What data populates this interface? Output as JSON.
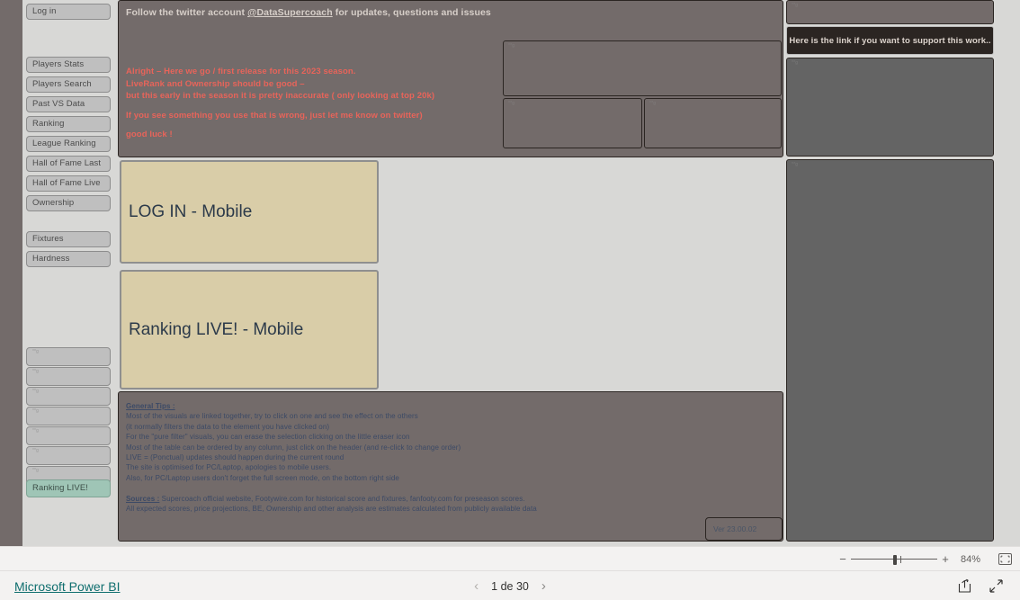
{
  "app": {
    "bottom_link": "Microsoft Power BI",
    "page_label": "1 de 30",
    "zoom_level": "84%",
    "prev_icon": "chevron-left-icon",
    "next_icon": "chevron-right-icon",
    "zoom_out_icon": "minus-icon",
    "zoom_in_icon": "plus-icon",
    "fit_icon": "fit-to-page-icon",
    "share_icon": "share-icon",
    "fullscreen_icon": "fullscreen-icon"
  },
  "sidebar": {
    "items": [
      {
        "label": "Log in",
        "active": false
      },
      {
        "label": "Players Stats",
        "active": false
      },
      {
        "label": "Players Search",
        "active": false
      },
      {
        "label": "Past VS Data",
        "active": false
      },
      {
        "label": "Ranking",
        "active": false
      },
      {
        "label": "League Ranking",
        "active": false
      },
      {
        "label": "Hall of Fame Last",
        "active": false
      },
      {
        "label": "Hall of Fame Live",
        "active": false
      },
      {
        "label": "Ownership",
        "active": false
      },
      {
        "label": "Fixtures",
        "active": false
      },
      {
        "label": "Hardness",
        "active": false
      }
    ],
    "blank_items": [
      {
        "label": "**g"
      },
      {
        "label": "**g"
      },
      {
        "label": "**g"
      },
      {
        "label": "**g"
      },
      {
        "label": "**g"
      },
      {
        "label": "**g"
      },
      {
        "label": "**g"
      }
    ],
    "live_item": {
      "label": "Ranking LIVE!"
    }
  },
  "top_card": {
    "twitter_prefix": "Follow the twitter account ",
    "twitter_handle": "@DataSupercoach",
    "twitter_suffix": " for updates, questions and issues",
    "release_line1": "Alright – Here we go / first release for this 2023 season.",
    "release_line2": "LiveRank and Ownership should be good –",
    "release_line3": "but  this early in the season it is pretty inaccurate ( only looking at top 20k)",
    "release_line4": "If you see something you use that is wrong, just let me know on twitter)",
    "release_line5": "good luck !"
  },
  "tiles": {
    "login": "LOG IN - Mobile",
    "ranking_live": "Ranking LIVE! - Mobile"
  },
  "tips": {
    "general_heading": "General Tips :",
    "general_lines": [
      "Most of the visuals are linked together, try to click on one and see the effect on the others",
      "(it normally filters the data to the element you have clicked on)",
      "For the \"pure filter\" visuals, you can erase the selection clicking on the little eraser icon",
      "Most of the table can be ordered by any column, just click on the header (and re-click to change order)",
      "LIVE = (Ponctual) updates should happen during  the current round",
      "The site is optimised for PC/Laptop, apologies to mobile users.",
      "Also, for PC/Laptop users don't forget the full screen mode,  on the bottom right side"
    ],
    "sources_heading": "Sources :",
    "sources_lines": [
      " Supercoach official website,  Footywire.com for historical score and fixtures, fanfooty.com for preseason scores.",
      "All expected scores, price projections, BE, Ownership and other analysis are estimates calculated from publicly available data"
    ],
    "version": "Ver 23.00.02"
  },
  "right_column": {
    "support_text": "Here is the link if you want to support this work..",
    "placeholder_label": "**g"
  },
  "placeholders": {
    "label": "**g"
  },
  "colors": {
    "canvas": "#d8d8d6",
    "mauve_panel": "#736b6a",
    "grey_panel": "#646464",
    "tile": "#d9cda8",
    "accent_red": "#e8645a",
    "tips_blue": "#3c4a66",
    "live_green": "#9fc5b6",
    "pbi_link": "#0f6e6e"
  }
}
